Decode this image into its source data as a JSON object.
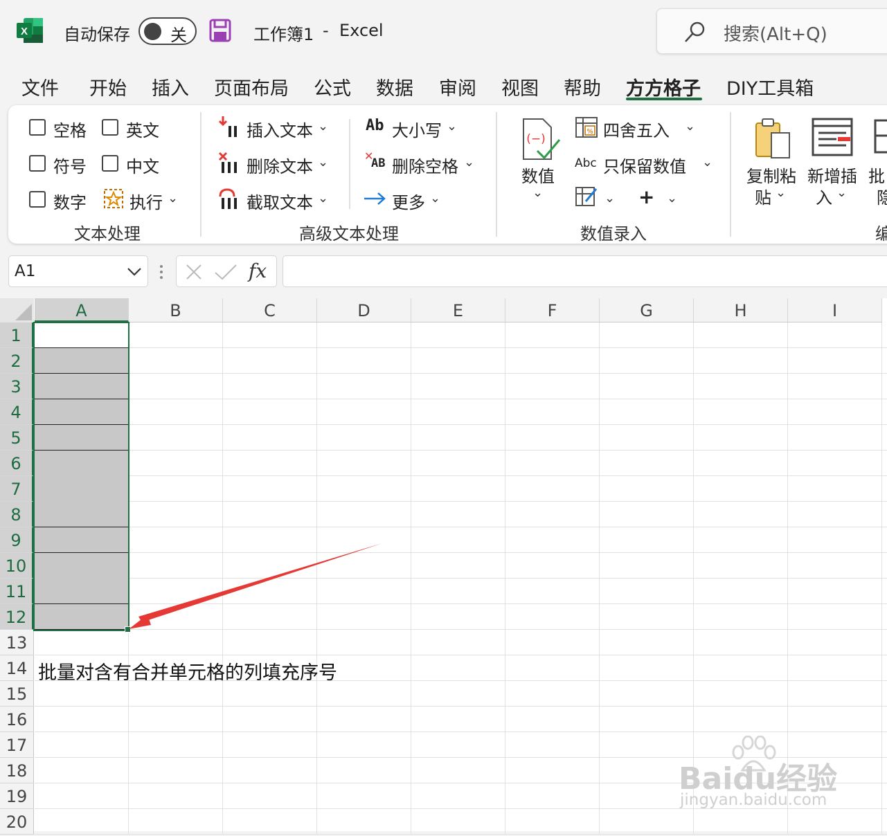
{
  "titlebar": {
    "autosave_label": "自动保存",
    "toggle_state": "关",
    "doc_title": "工作簿1",
    "separator": "-",
    "app_name": "Excel",
    "search_placeholder": "搜索(Alt+Q)"
  },
  "tabs": [
    "文件",
    "开始",
    "插入",
    "页面布局",
    "公式",
    "数据",
    "审阅",
    "视图",
    "帮助",
    "方方格子",
    "DIY工具箱"
  ],
  "active_tab": "方方格子",
  "ribbon": {
    "text_group": {
      "label": "文本处理",
      "space": "空格",
      "english": "英文",
      "symbol": "符号",
      "chinese": "中文",
      "number": "数字",
      "execute": "执行"
    },
    "adv_group": {
      "label": "高级文本处理",
      "insert_text": "插入文本",
      "delete_text": "删除文本",
      "extract_text": "截取文本",
      "case_icon": "Ab",
      "case": "大小写",
      "delete_space_icon": "AB",
      "delete_space": "删除空格",
      "more": "更多"
    },
    "num_group": {
      "label": "数值录入",
      "value": "数值",
      "round": "四舍五入",
      "keep_num_icon": "Abc",
      "keep_num": "只保留数值",
      "plus": "+"
    },
    "next_group": {
      "copy_paste_1": "复制粘",
      "copy_paste_2": "贴",
      "new_insert_1": "新增插",
      "new_insert_2": "入",
      "batch_1": "批",
      "batch_2": "隐",
      "label_partial": "编"
    }
  },
  "formula": {
    "name_box": "A1",
    "fx": "fx"
  },
  "sheet": {
    "columns": [
      "A",
      "B",
      "C",
      "D",
      "E",
      "F",
      "G",
      "H",
      "I"
    ],
    "rows": [
      "1",
      "2",
      "3",
      "4",
      "5",
      "6",
      "7",
      "8",
      "9",
      "10",
      "11",
      "12",
      "13",
      "14",
      "15",
      "16",
      "17",
      "18",
      "19",
      "20"
    ],
    "cell_A14": "批量对含有合并单元格的列填充序号",
    "selection": "A1:A12"
  },
  "watermark": {
    "brand": "Baidu经验",
    "url": "jingyan.baidu.com"
  },
  "colors": {
    "excel_green": "#1e7145",
    "arrow_red": "#e53935",
    "save_purple": "#9b3fb5",
    "merged_fill": "#c8c8c8"
  }
}
